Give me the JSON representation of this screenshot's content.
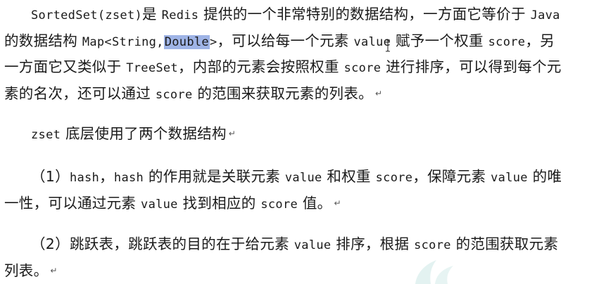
{
  "paragraphs": {
    "p1": {
      "line1": {
        "t1": "SortedSet(zset)",
        "t2": "是 ",
        "t3": "Redis",
        "t4": " 提供的一个非常特别的数据结构，一方面它等价于 ",
        "t5": "Java"
      },
      "line2": {
        "t1": "的数据结构 ",
        "t2": "Map<String,",
        "t3": "Double",
        "t4": ">",
        "t5": "，可以给每一个元素 ",
        "t6": "value",
        "t7": " 赋予一个权重 ",
        "t8": "score",
        "t9": "，另"
      },
      "line3": {
        "t1": "一方面它又类似于 ",
        "t2": "TreeSet",
        "t3": "，内部的元素会按照权重 ",
        "t4": "score",
        "t5": " 进行排序，可以得到每个元"
      },
      "line4": {
        "t1": "素的名次，还可以通过 ",
        "t2": "score",
        "t3": " 的范围来获取元素的列表。"
      }
    },
    "p2": {
      "t1": "zset",
      "t2": " 底层使用了两个数据结构"
    },
    "p3": {
      "line1": {
        "t1": "（1）",
        "t2": "hash",
        "t3": "，",
        "t4": "hash",
        "t5": " 的作用就是关联元素 ",
        "t6": "value",
        "t7": " 和权重 ",
        "t8": "score",
        "t9": "，保障元素 ",
        "t10": "value",
        "t11": " 的唯"
      },
      "line2": {
        "t1": "一性，可以通过元素 ",
        "t2": "value",
        "t3": " 找到相应的 ",
        "t4": "score",
        "t5": " 值。"
      }
    },
    "p4": {
      "line1": {
        "t1": "（2）跳跃表，跳跃表的目的在于给元素 ",
        "t2": "value",
        "t3": " 排序，根据 ",
        "t4": "score",
        "t5": " 的范围获取元素"
      },
      "line2": {
        "t1": "列表。"
      }
    }
  },
  "paragraph_mark": "↵",
  "icons": {
    "cursor": "ibeam-cursor-icon",
    "watermark": "watermark-logo"
  },
  "colors": {
    "selection_highlight": "#9fb4e6",
    "text": "#1a1a1a"
  }
}
